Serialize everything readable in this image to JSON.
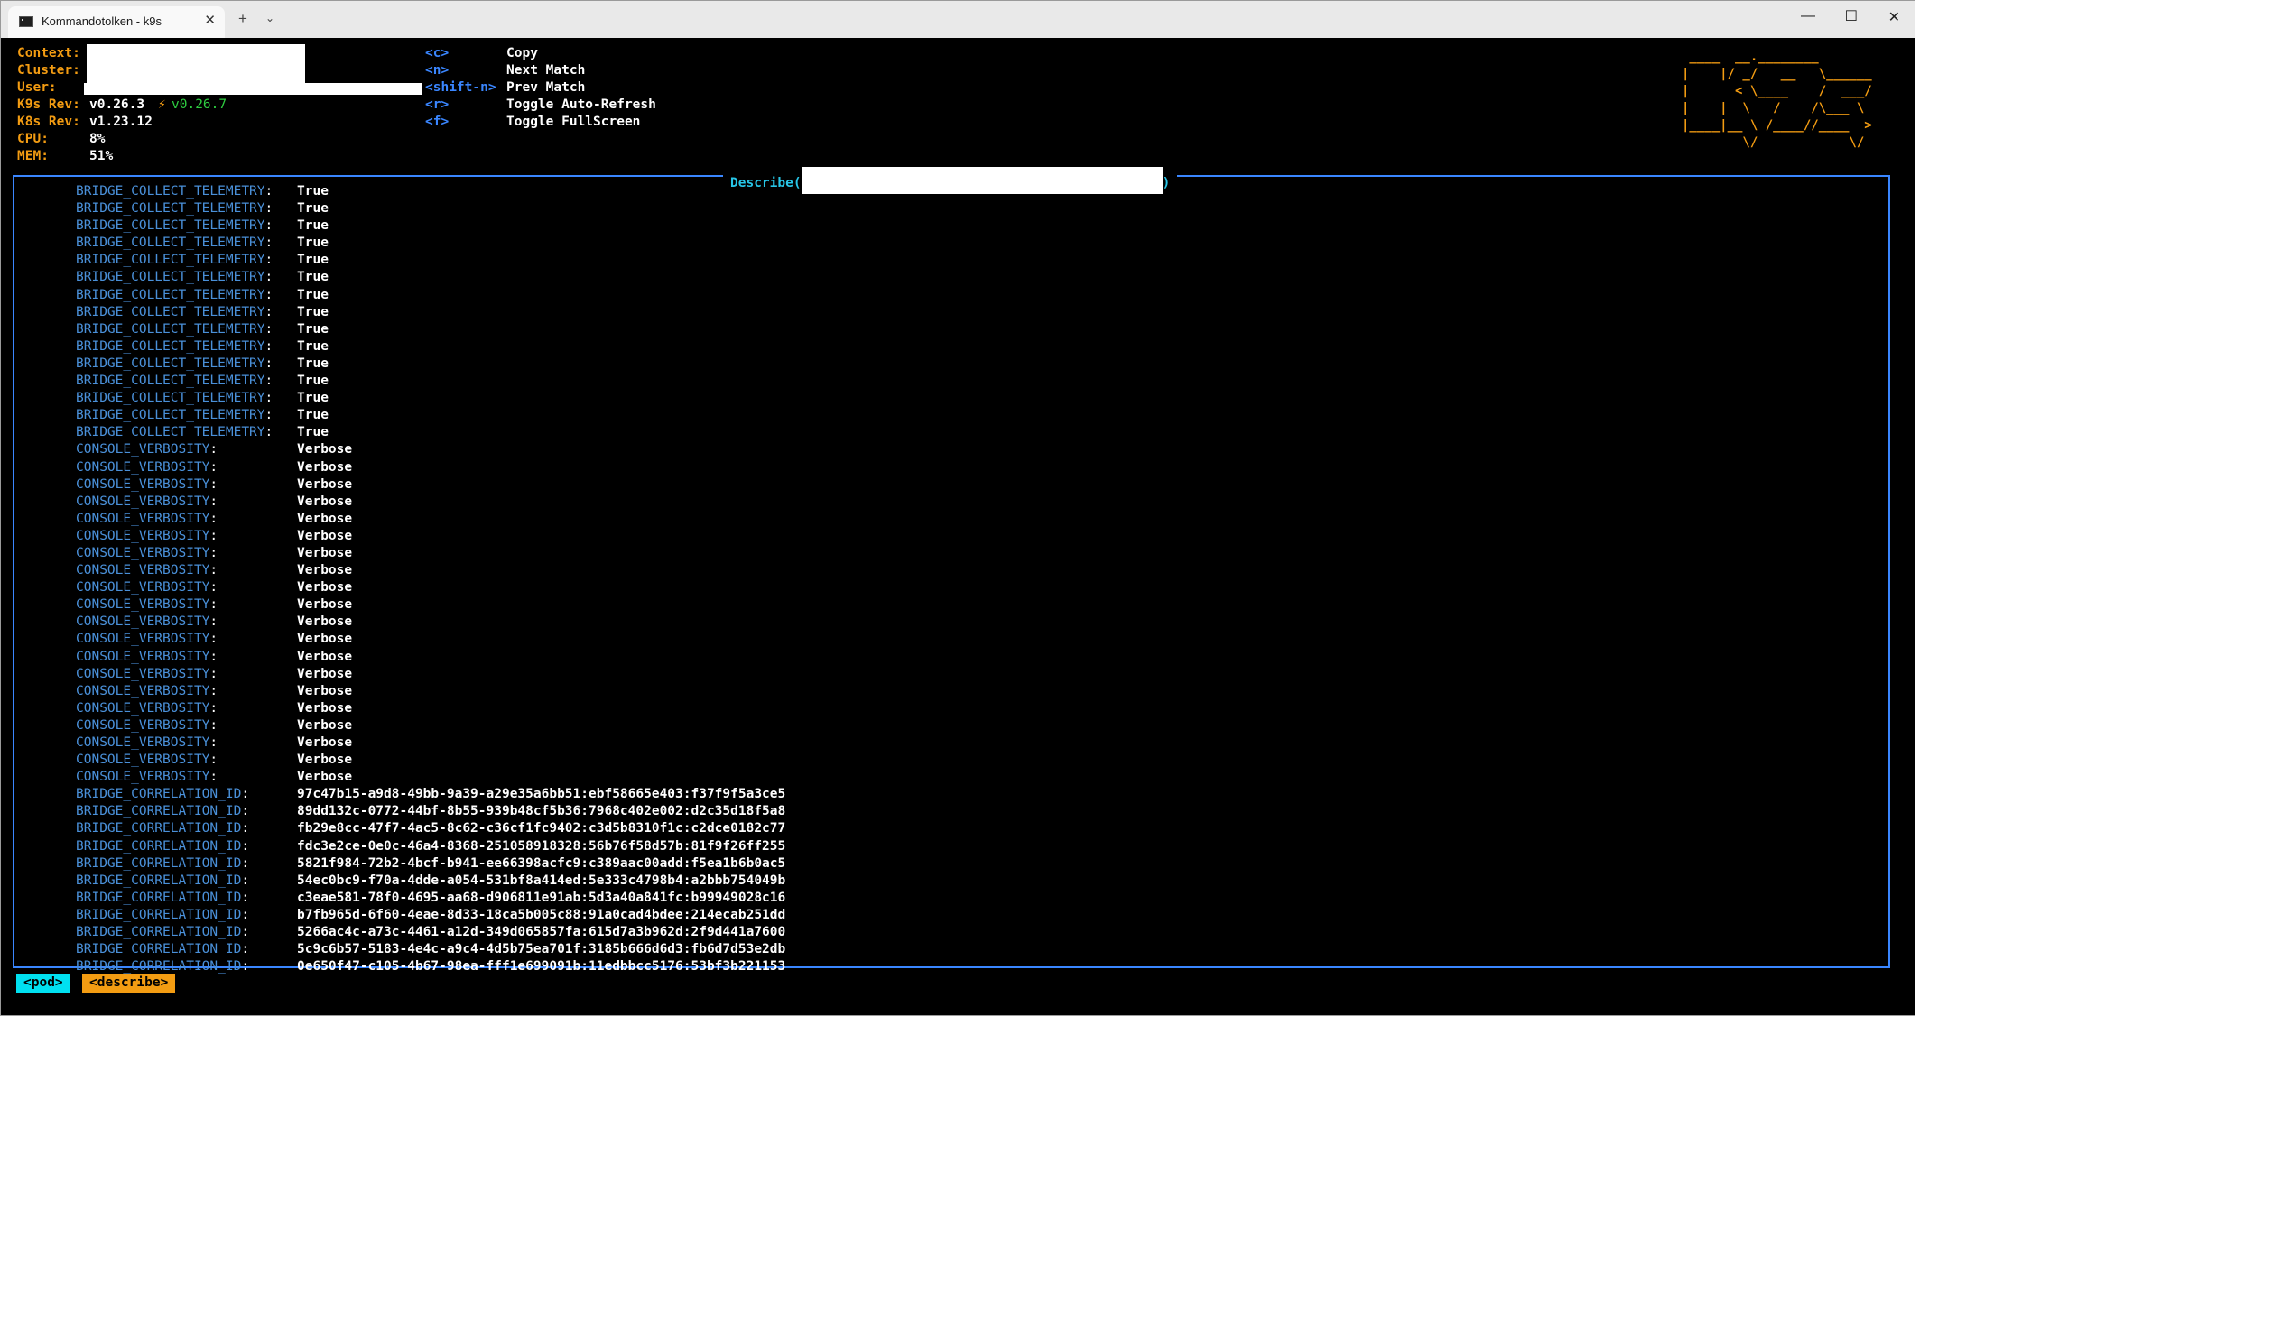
{
  "window": {
    "tab_title": "Kommandotolken - k9s",
    "tab_close": "✕",
    "new_tab": "+",
    "tab_dropdown": "⌄",
    "minimize": "—",
    "maximize": "☐",
    "close": "✕"
  },
  "header": {
    "context_label": "Context:",
    "cluster_label": "Cluster:",
    "user_label": "User:",
    "k9s_rev_label": "K9s Rev:",
    "k9s_rev_value": "v0.26.3",
    "k9s_new_rev": "v0.26.7",
    "upgrade_icon": "⚡",
    "k8s_rev_label": "K8s Rev:",
    "k8s_rev_value": "v1.23.12",
    "cpu_label": "CPU:",
    "cpu_value": "8%",
    "mem_label": "MEM:",
    "mem_value": "51%"
  },
  "hints": [
    {
      "key": "<c>",
      "desc": "Copy"
    },
    {
      "key": "<n>",
      "desc": "Next Match"
    },
    {
      "key": "<shift-n>",
      "desc": "Prev Match"
    },
    {
      "key": "<r>",
      "desc": "Toggle Auto-Refresh"
    },
    {
      "key": "<f>",
      "desc": "Toggle FullScreen"
    }
  ],
  "logo": " ____  __.________\n|    |/ _/   __   \\______\n|      < \\____    /  ___/\n|    |  \\   /    /\\___ \\\n|____|__ \\ /____//____  >\n        \\/            \\/",
  "describe": {
    "title_prefix": "Describe(",
    "title_suffix": ")"
  },
  "env_rows": [
    {
      "key": "BRIDGE_COLLECT_TELEMETRY",
      "value": "True"
    },
    {
      "key": "BRIDGE_COLLECT_TELEMETRY",
      "value": "True"
    },
    {
      "key": "BRIDGE_COLLECT_TELEMETRY",
      "value": "True"
    },
    {
      "key": "BRIDGE_COLLECT_TELEMETRY",
      "value": "True"
    },
    {
      "key": "BRIDGE_COLLECT_TELEMETRY",
      "value": "True"
    },
    {
      "key": "BRIDGE_COLLECT_TELEMETRY",
      "value": "True"
    },
    {
      "key": "BRIDGE_COLLECT_TELEMETRY",
      "value": "True"
    },
    {
      "key": "BRIDGE_COLLECT_TELEMETRY",
      "value": "True"
    },
    {
      "key": "BRIDGE_COLLECT_TELEMETRY",
      "value": "True"
    },
    {
      "key": "BRIDGE_COLLECT_TELEMETRY",
      "value": "True"
    },
    {
      "key": "BRIDGE_COLLECT_TELEMETRY",
      "value": "True"
    },
    {
      "key": "BRIDGE_COLLECT_TELEMETRY",
      "value": "True"
    },
    {
      "key": "BRIDGE_COLLECT_TELEMETRY",
      "value": "True"
    },
    {
      "key": "BRIDGE_COLLECT_TELEMETRY",
      "value": "True"
    },
    {
      "key": "BRIDGE_COLLECT_TELEMETRY",
      "value": "True"
    },
    {
      "key": "CONSOLE_VERBOSITY",
      "value": "Verbose"
    },
    {
      "key": "CONSOLE_VERBOSITY",
      "value": "Verbose"
    },
    {
      "key": "CONSOLE_VERBOSITY",
      "value": "Verbose"
    },
    {
      "key": "CONSOLE_VERBOSITY",
      "value": "Verbose"
    },
    {
      "key": "CONSOLE_VERBOSITY",
      "value": "Verbose"
    },
    {
      "key": "CONSOLE_VERBOSITY",
      "value": "Verbose"
    },
    {
      "key": "CONSOLE_VERBOSITY",
      "value": "Verbose"
    },
    {
      "key": "CONSOLE_VERBOSITY",
      "value": "Verbose"
    },
    {
      "key": "CONSOLE_VERBOSITY",
      "value": "Verbose"
    },
    {
      "key": "CONSOLE_VERBOSITY",
      "value": "Verbose"
    },
    {
      "key": "CONSOLE_VERBOSITY",
      "value": "Verbose"
    },
    {
      "key": "CONSOLE_VERBOSITY",
      "value": "Verbose"
    },
    {
      "key": "CONSOLE_VERBOSITY",
      "value": "Verbose"
    },
    {
      "key": "CONSOLE_VERBOSITY",
      "value": "Verbose"
    },
    {
      "key": "CONSOLE_VERBOSITY",
      "value": "Verbose"
    },
    {
      "key": "CONSOLE_VERBOSITY",
      "value": "Verbose"
    },
    {
      "key": "CONSOLE_VERBOSITY",
      "value": "Verbose"
    },
    {
      "key": "CONSOLE_VERBOSITY",
      "value": "Verbose"
    },
    {
      "key": "CONSOLE_VERBOSITY",
      "value": "Verbose"
    },
    {
      "key": "CONSOLE_VERBOSITY",
      "value": "Verbose"
    },
    {
      "key": "BRIDGE_CORRELATION_ID",
      "value": "97c47b15-a9d8-49bb-9a39-a29e35a6bb51:ebf58665e403:f37f9f5a3ce5"
    },
    {
      "key": "BRIDGE_CORRELATION_ID",
      "value": "89dd132c-0772-44bf-8b55-939b48cf5b36:7968c402e002:d2c35d18f5a8"
    },
    {
      "key": "BRIDGE_CORRELATION_ID",
      "value": "fb29e8cc-47f7-4ac5-8c62-c36cf1fc9402:c3d5b8310f1c:c2dce0182c77"
    },
    {
      "key": "BRIDGE_CORRELATION_ID",
      "value": "fdc3e2ce-0e0c-46a4-8368-251058918328:56b76f58d57b:81f9f26ff255"
    },
    {
      "key": "BRIDGE_CORRELATION_ID",
      "value": "5821f984-72b2-4bcf-b941-ee66398acfc9:c389aac00add:f5ea1b6b0ac5"
    },
    {
      "key": "BRIDGE_CORRELATION_ID",
      "value": "54ec0bc9-f70a-4dde-a054-531bf8a414ed:5e333c4798b4:a2bbb754049b"
    },
    {
      "key": "BRIDGE_CORRELATION_ID",
      "value": "c3eae581-78f0-4695-aa68-d906811e91ab:5d3a40a841fc:b99949028c16"
    },
    {
      "key": "BRIDGE_CORRELATION_ID",
      "value": "b7fb965d-6f60-4eae-8d33-18ca5b005c88:91a0cad4bdee:214ecab251dd"
    },
    {
      "key": "BRIDGE_CORRELATION_ID",
      "value": "5266ac4c-a73c-4461-a12d-349d065857fa:615d7a3b962d:2f9d441a7600"
    },
    {
      "key": "BRIDGE_CORRELATION_ID",
      "value": "5c9c6b57-5183-4e4c-a9c4-4d5b75ea701f:3185b666d6d3:fb6d7d53e2db"
    },
    {
      "key": "BRIDGE_CORRELATION_ID",
      "value": "0e650f47-c105-4b67-98ea-fff1e699091b:11edbbcc5176:53bf3b221153"
    }
  ],
  "crumbs": {
    "pod": "<pod>",
    "describe": "<describe>"
  }
}
